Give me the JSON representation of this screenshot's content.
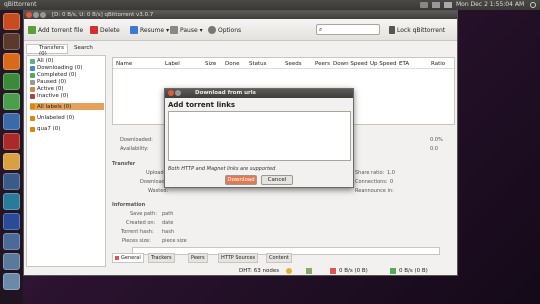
{
  "topbar": {
    "app": "qBittorrent",
    "clock": "Mon Dec  2  1:55:04 AM",
    "user_icon": "power-icon"
  },
  "window": {
    "title": "[D: 0 B/s, U: 0 B/s] qBittorrent v3.0.7"
  },
  "toolbar": {
    "add_file": "Add torrent file",
    "delete": "Delete",
    "resume": "Resume",
    "pause": "Pause",
    "options": "Options",
    "lock": "Lock qBittorrent"
  },
  "sidebar": {
    "tab_transfers": "Transfers (0)",
    "tab_search": "Search",
    "status": [
      {
        "label": "All (0)"
      },
      {
        "label": "Downloading (0)"
      },
      {
        "label": "Completed (0)"
      },
      {
        "label": "Paused (0)"
      },
      {
        "label": "Active (0)"
      },
      {
        "label": "Inactive (0)"
      }
    ],
    "labels": [
      {
        "label": "All labels (0)"
      },
      {
        "label": "Unlabeled (0)"
      },
      {
        "label": "qua7 (0)"
      }
    ]
  },
  "columns": [
    "Name",
    "Label",
    "Size",
    "Done",
    "Status",
    "Seeds",
    "Peers",
    "Down Speed",
    "Up Speed",
    "ETA",
    "Ratio"
  ],
  "props": {
    "downloaded": "Downloaded:",
    "availability": "Availability:",
    "pct1": "0.0%",
    "pct2": "0.0",
    "transfer": "Transfer",
    "uploaded": "Uploaded:",
    "downloaded2": "Downloaded:",
    "wasted": "Wasted:",
    "share_ratio": "Share ratio:",
    "ratio_val": "1.0",
    "connections": "Connections:",
    "conn_val": "0",
    "reannounce": "Reannounce in:",
    "information": "Information",
    "save_path": "Save path:",
    "save_path_val": "path",
    "created_on": "Created on:",
    "created_on_val": "date",
    "torrent_hash": "Torrent hash:",
    "hash_val": "hash",
    "pieces": "Pieces size:",
    "pieces_val": "piece size"
  },
  "proptabs": [
    "General",
    "Trackers",
    "Peers",
    "HTTP Sources",
    "Content"
  ],
  "status": {
    "dht": "DHT: 63 nodes",
    "down": "0 B/s (0 B)",
    "up": "0 B/s (0 B)"
  },
  "dialog": {
    "title": "Download from urls",
    "header": "Add torrent links",
    "text": "",
    "hint": "Both HTTP and Magnet links are supported",
    "download": "Download",
    "cancel": "Cancel"
  }
}
